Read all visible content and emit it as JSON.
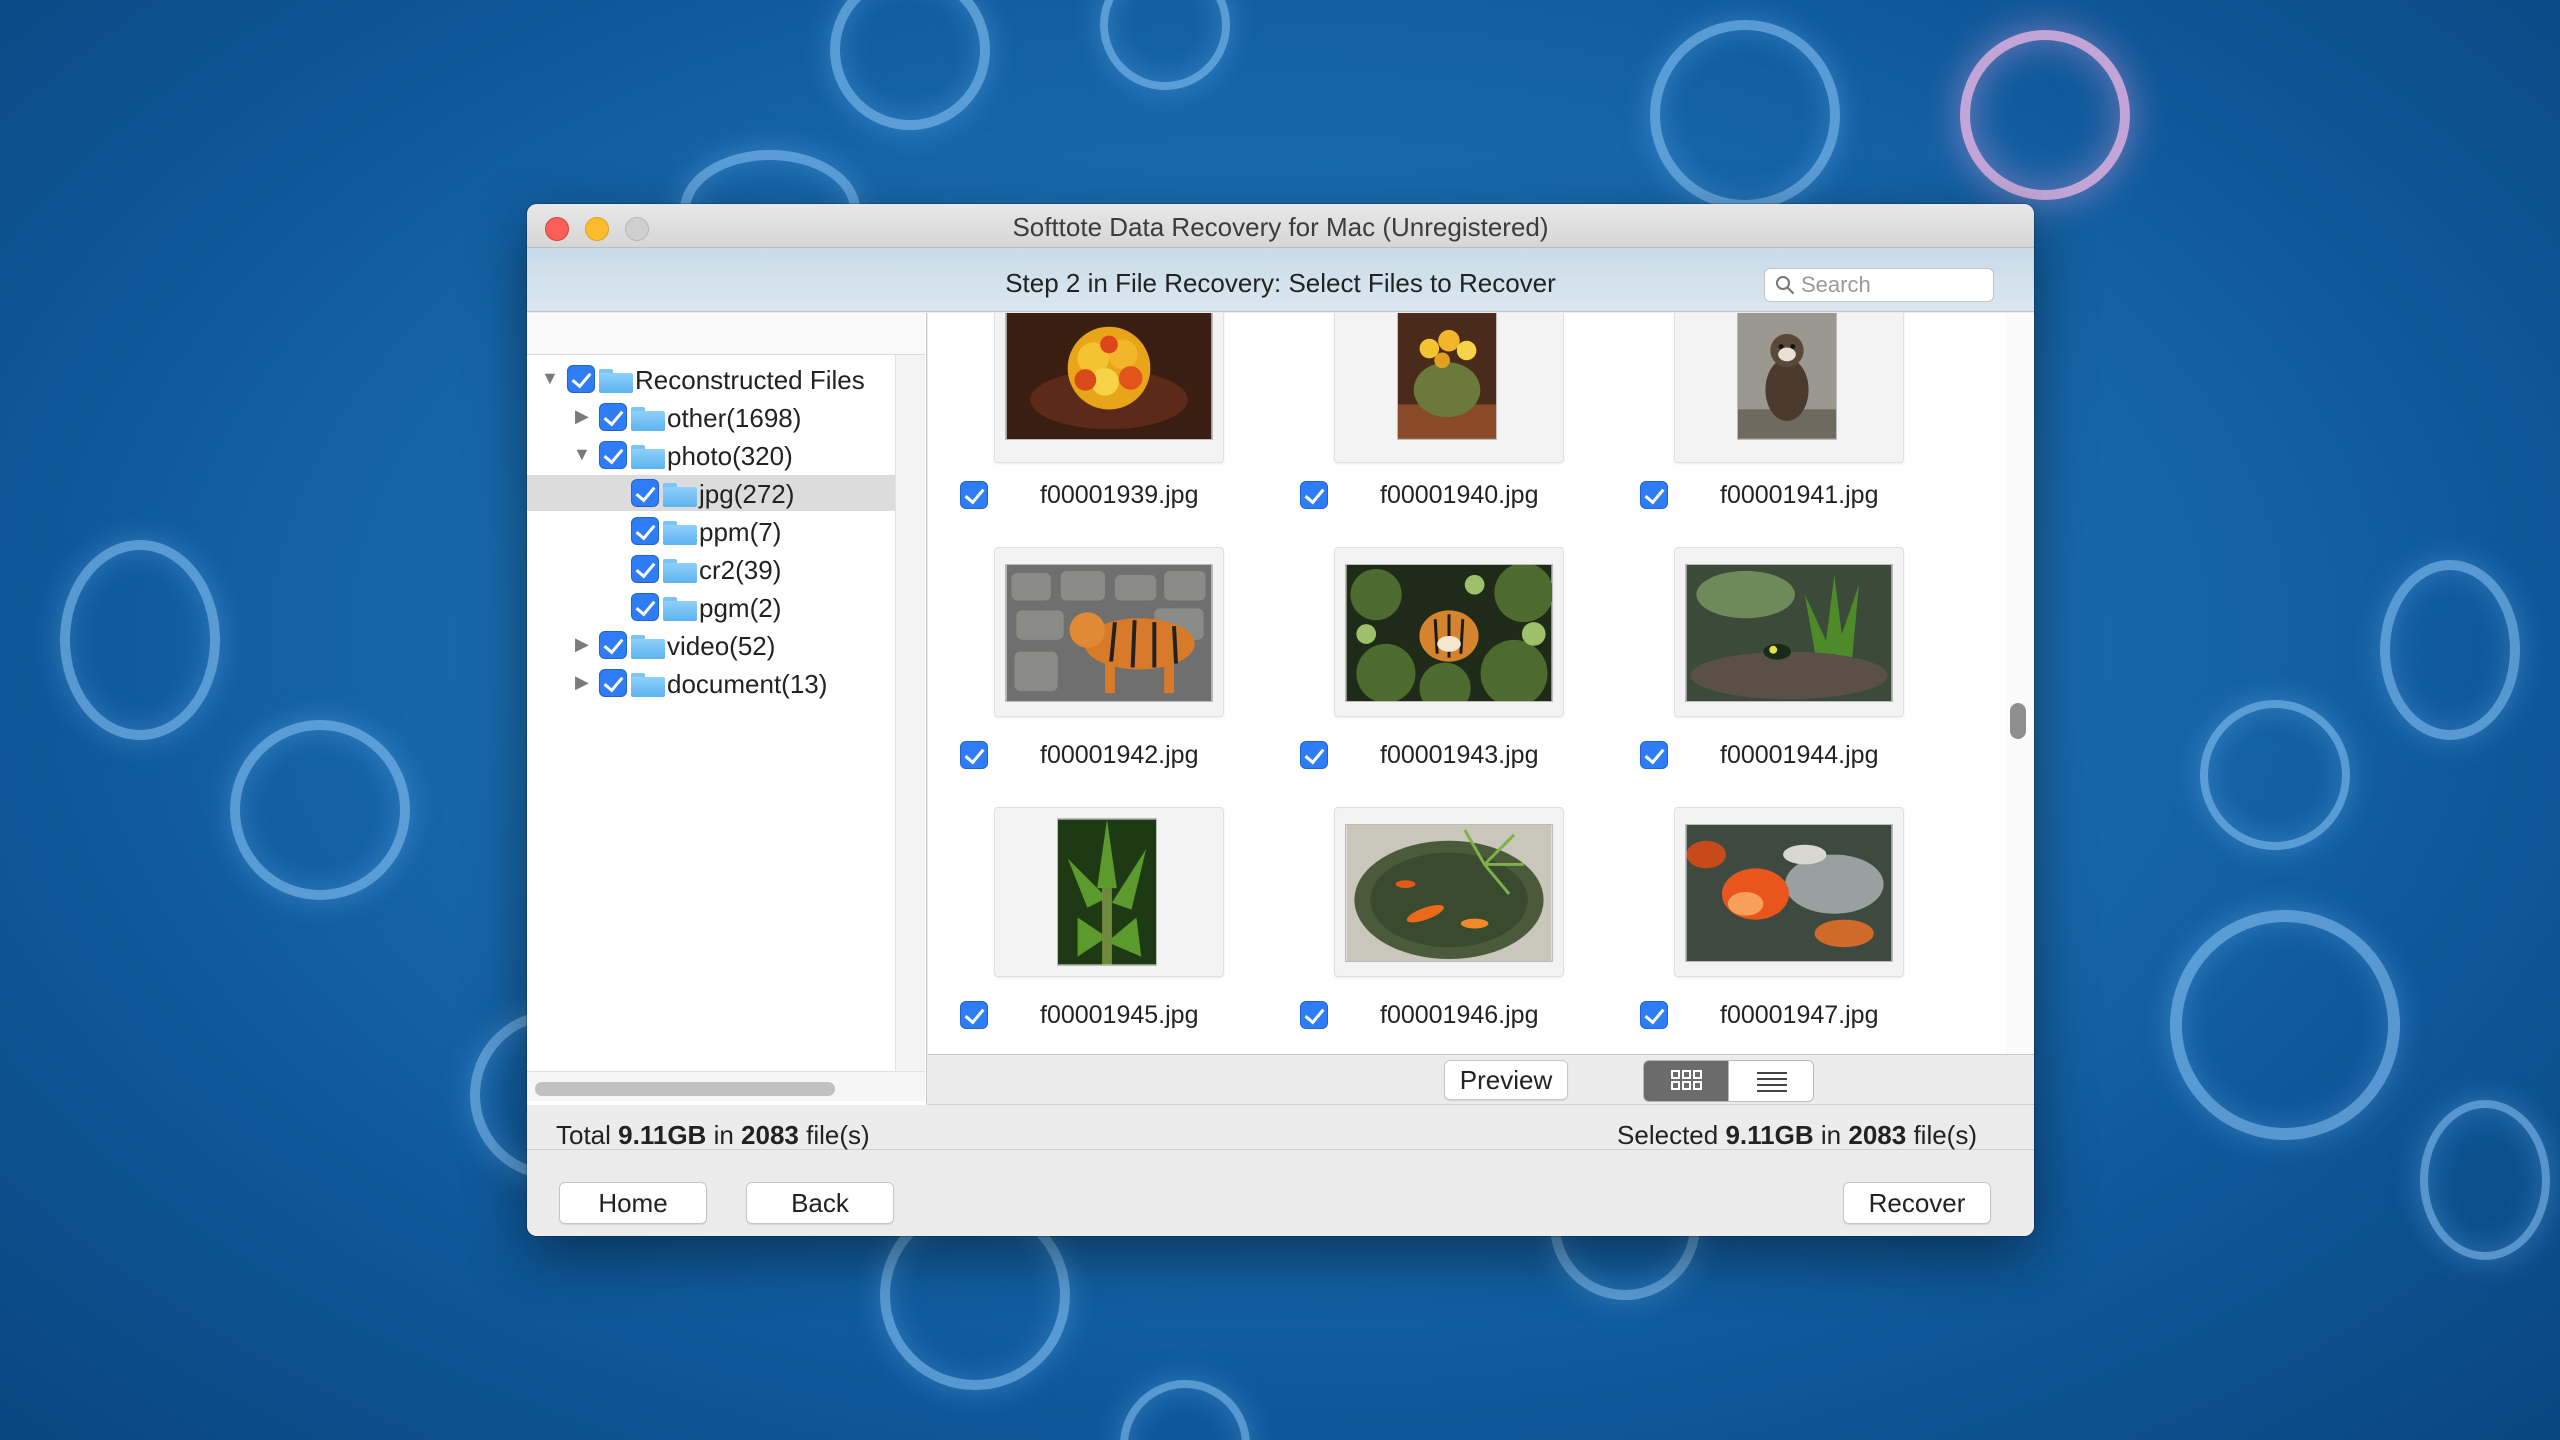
{
  "window": {
    "title": "Softtote Data Recovery for Mac (Unregistered)",
    "step_text": "Step 2 in File Recovery: Select Files to Recover",
    "search_placeholder": "Search"
  },
  "tree": [
    {
      "label": "Reconstructed Files",
      "expanded": true,
      "checked": true
    },
    {
      "label": "other(1698)",
      "expanded": false,
      "checked": true
    },
    {
      "label": "photo(320)",
      "expanded": true,
      "checked": true
    },
    {
      "label": "jpg(272)",
      "checked": true,
      "selected": true
    },
    {
      "label": "ppm(7)",
      "checked": true
    },
    {
      "label": "cr2(39)",
      "checked": true
    },
    {
      "label": "pgm(2)",
      "checked": true
    },
    {
      "label": "video(52)",
      "expanded": false,
      "checked": true
    },
    {
      "label": "document(13)",
      "expanded": false,
      "checked": true
    }
  ],
  "files": [
    {
      "name": "f00001939.jpg",
      "checked": true,
      "subject": "yellow-cactus-flower"
    },
    {
      "name": "f00001940.jpg",
      "checked": true,
      "subject": "potted-cactus"
    },
    {
      "name": "f00001941.jpg",
      "checked": true,
      "subject": "monkey"
    },
    {
      "name": "f00001942.jpg",
      "checked": true,
      "subject": "tiger-on-rocks"
    },
    {
      "name": "f00001943.jpg",
      "checked": true,
      "subject": "tiger-in-foliage"
    },
    {
      "name": "f00001944.jpg",
      "checked": true,
      "subject": "frog-on-log"
    },
    {
      "name": "f00001945.jpg",
      "checked": true,
      "subject": "banana-plant"
    },
    {
      "name": "f00001946.jpg",
      "checked": true,
      "subject": "koi-pond"
    },
    {
      "name": "f00001947.jpg",
      "checked": true,
      "subject": "goldfish"
    }
  ],
  "toolbar": {
    "preview_label": "Preview",
    "grid_view_icon": "grid-view-icon",
    "list_view_icon": "list-view-icon"
  },
  "status": {
    "total_prefix": "Total",
    "total_size": "9.11GB",
    "total_in": "in",
    "total_count": "2083",
    "total_suffix": "file(s)",
    "selected_prefix": "Selected",
    "selected_size": "9.11GB",
    "selected_in": "in",
    "selected_count": "2083",
    "selected_suffix": "file(s)"
  },
  "footer": {
    "home_label": "Home",
    "back_label": "Back",
    "recover_label": "Recover"
  },
  "colors": {
    "checkbox": "#2f7df6",
    "close": "#fc5f57",
    "minimize": "#fdbc2e",
    "desktop": "#1b6fb3"
  }
}
